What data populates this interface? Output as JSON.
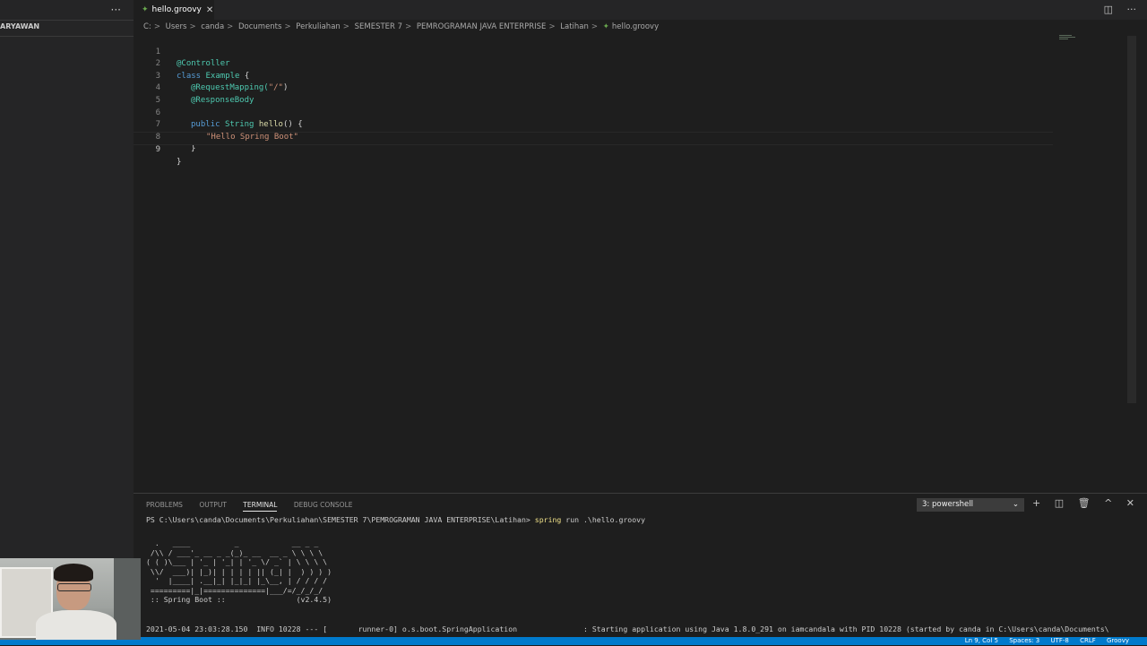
{
  "sidebar": {
    "more_label": "···",
    "section_title": "ARYAWAN"
  },
  "tab": {
    "icon": "groovy-icon",
    "label": "hello.groovy",
    "close": "✕"
  },
  "tab_actions": {
    "split": "◫",
    "more": "···"
  },
  "breadcrumb": [
    "C:",
    "Users",
    "canda",
    "Documents",
    "Perkuliahan",
    "SEMESTER 7",
    "PEMROGRAMAN JAVA ENTERPRISE",
    "Latihan",
    "hello.groovy"
  ],
  "breadcrumb_sep": ">",
  "editor": {
    "line_numbers": [
      "1",
      "2",
      "3",
      "4",
      "5",
      "6",
      "7",
      "8",
      "9"
    ],
    "lines": {
      "l1": "@Controller",
      "l2_kw": "class",
      "l2_name": "Example",
      "l2_brace": " {",
      "l3_ann": "@RequestMapping(",
      "l3_str": "\"/\"",
      "l3_close": ")",
      "l4": "@ResponseBody",
      "l6_kw": "public",
      "l6_type": "String",
      "l6_fn": "hello",
      "l6_rest": "() {",
      "l7": "\"Hello Spring Boot\"",
      "l8": "}",
      "l9": "}"
    }
  },
  "panel": {
    "tabs": [
      "PROBLEMS",
      "OUTPUT",
      "TERMINAL",
      "DEBUG CONSOLE"
    ],
    "active_tab": "TERMINAL",
    "terminal_select": "3: powershell",
    "actions": [
      "+",
      "◫",
      "🗑",
      "^",
      "✕"
    ]
  },
  "terminal": {
    "prompt": "PS C:\\Users\\canda\\Documents\\Perkuliahan\\SEMESTER 7\\PEMROGRAMAN JAVA ENTERPRISE\\Latihan> ",
    "command_word": "spring",
    "command_rest": " run .\\hello.groovy",
    "ascii_banner": "  .   ____          _            __ _ _\n /\\\\ / ___'_ __ _ _(_)_ __  __ _ \\ \\ \\ \\\n( ( )\\___ | '_ | '_| | '_ \\/ _` | \\ \\ \\ \\\n \\\\/  ___)| |_)| | | | | || (_| |  ) ) ) )\n  '  |____| .__|_| |_|_| |_\\__, | / / / /\n =========|_|==============|___/=/_/_/_/\n :: Spring Boot ::                (v2.4.5)",
    "log_line": "2021-05-04 23:03:28.150  INFO 10228 --- [       runner-0] o.s.boot.SpringApplication               : Starting application using Java 1.8.0_291 on iamcandala with PID 10228 (started by canda in C:\\Users\\canda\\Documents\\"
  },
  "statusbar": [
    "Ln 9, Col 5",
    "Spaces: 3",
    "UTF-8",
    "CRLF",
    "Groovy"
  ],
  "colors": {
    "accent": "#007acc",
    "editor_bg": "#1e1e1e",
    "sidebar_bg": "#252526",
    "keyword": "#569cd6",
    "annotation": "#4ec9b0",
    "string": "#ce9178",
    "function": "#dcdcaa"
  }
}
